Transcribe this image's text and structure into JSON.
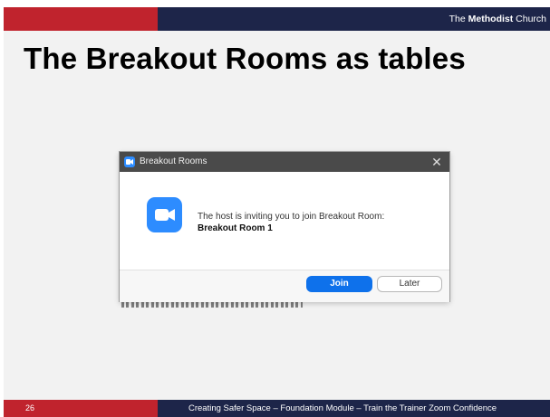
{
  "header": {
    "brand_prefix": "The ",
    "brand_bold": "Methodist",
    "brand_suffix": " Church"
  },
  "slide": {
    "title": "The Breakout Rooms as tables"
  },
  "dialog": {
    "title": "Breakout Rooms",
    "close_glyph": "✕",
    "message": "The host is inviting you to join Breakout Room:",
    "room_name": "Breakout Room 1",
    "join_label": "Join",
    "later_label": "Later"
  },
  "footer": {
    "page_number": "26",
    "text": "Creating Safer Space – Foundation Module – Train the Trainer Zoom Confidence"
  },
  "colors": {
    "brand_red": "#c0232d",
    "brand_navy": "#1d2549",
    "zoom_blue": "#2d8cff",
    "join_blue": "#0e71eb"
  },
  "icons": [
    "zoom-app-icon",
    "zoom-video-icon",
    "close-icon"
  ]
}
